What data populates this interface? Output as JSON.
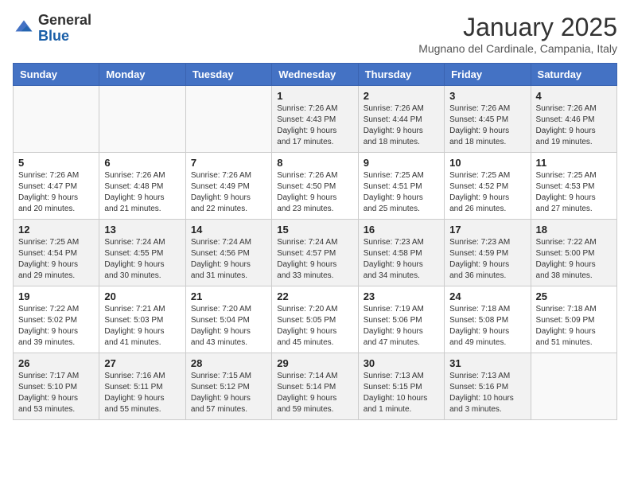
{
  "header": {
    "logo_general": "General",
    "logo_blue": "Blue",
    "month_year": "January 2025",
    "location": "Mugnano del Cardinale, Campania, Italy"
  },
  "weekdays": [
    "Sunday",
    "Monday",
    "Tuesday",
    "Wednesday",
    "Thursday",
    "Friday",
    "Saturday"
  ],
  "weeks": [
    [
      {
        "day": "",
        "info": ""
      },
      {
        "day": "",
        "info": ""
      },
      {
        "day": "",
        "info": ""
      },
      {
        "day": "1",
        "info": "Sunrise: 7:26 AM\nSunset: 4:43 PM\nDaylight: 9 hours\nand 17 minutes."
      },
      {
        "day": "2",
        "info": "Sunrise: 7:26 AM\nSunset: 4:44 PM\nDaylight: 9 hours\nand 18 minutes."
      },
      {
        "day": "3",
        "info": "Sunrise: 7:26 AM\nSunset: 4:45 PM\nDaylight: 9 hours\nand 18 minutes."
      },
      {
        "day": "4",
        "info": "Sunrise: 7:26 AM\nSunset: 4:46 PM\nDaylight: 9 hours\nand 19 minutes."
      }
    ],
    [
      {
        "day": "5",
        "info": "Sunrise: 7:26 AM\nSunset: 4:47 PM\nDaylight: 9 hours\nand 20 minutes."
      },
      {
        "day": "6",
        "info": "Sunrise: 7:26 AM\nSunset: 4:48 PM\nDaylight: 9 hours\nand 21 minutes."
      },
      {
        "day": "7",
        "info": "Sunrise: 7:26 AM\nSunset: 4:49 PM\nDaylight: 9 hours\nand 22 minutes."
      },
      {
        "day": "8",
        "info": "Sunrise: 7:26 AM\nSunset: 4:50 PM\nDaylight: 9 hours\nand 23 minutes."
      },
      {
        "day": "9",
        "info": "Sunrise: 7:25 AM\nSunset: 4:51 PM\nDaylight: 9 hours\nand 25 minutes."
      },
      {
        "day": "10",
        "info": "Sunrise: 7:25 AM\nSunset: 4:52 PM\nDaylight: 9 hours\nand 26 minutes."
      },
      {
        "day": "11",
        "info": "Sunrise: 7:25 AM\nSunset: 4:53 PM\nDaylight: 9 hours\nand 27 minutes."
      }
    ],
    [
      {
        "day": "12",
        "info": "Sunrise: 7:25 AM\nSunset: 4:54 PM\nDaylight: 9 hours\nand 29 minutes."
      },
      {
        "day": "13",
        "info": "Sunrise: 7:24 AM\nSunset: 4:55 PM\nDaylight: 9 hours\nand 30 minutes."
      },
      {
        "day": "14",
        "info": "Sunrise: 7:24 AM\nSunset: 4:56 PM\nDaylight: 9 hours\nand 31 minutes."
      },
      {
        "day": "15",
        "info": "Sunrise: 7:24 AM\nSunset: 4:57 PM\nDaylight: 9 hours\nand 33 minutes."
      },
      {
        "day": "16",
        "info": "Sunrise: 7:23 AM\nSunset: 4:58 PM\nDaylight: 9 hours\nand 34 minutes."
      },
      {
        "day": "17",
        "info": "Sunrise: 7:23 AM\nSunset: 4:59 PM\nDaylight: 9 hours\nand 36 minutes."
      },
      {
        "day": "18",
        "info": "Sunrise: 7:22 AM\nSunset: 5:00 PM\nDaylight: 9 hours\nand 38 minutes."
      }
    ],
    [
      {
        "day": "19",
        "info": "Sunrise: 7:22 AM\nSunset: 5:02 PM\nDaylight: 9 hours\nand 39 minutes."
      },
      {
        "day": "20",
        "info": "Sunrise: 7:21 AM\nSunset: 5:03 PM\nDaylight: 9 hours\nand 41 minutes."
      },
      {
        "day": "21",
        "info": "Sunrise: 7:20 AM\nSunset: 5:04 PM\nDaylight: 9 hours\nand 43 minutes."
      },
      {
        "day": "22",
        "info": "Sunrise: 7:20 AM\nSunset: 5:05 PM\nDaylight: 9 hours\nand 45 minutes."
      },
      {
        "day": "23",
        "info": "Sunrise: 7:19 AM\nSunset: 5:06 PM\nDaylight: 9 hours\nand 47 minutes."
      },
      {
        "day": "24",
        "info": "Sunrise: 7:18 AM\nSunset: 5:08 PM\nDaylight: 9 hours\nand 49 minutes."
      },
      {
        "day": "25",
        "info": "Sunrise: 7:18 AM\nSunset: 5:09 PM\nDaylight: 9 hours\nand 51 minutes."
      }
    ],
    [
      {
        "day": "26",
        "info": "Sunrise: 7:17 AM\nSunset: 5:10 PM\nDaylight: 9 hours\nand 53 minutes."
      },
      {
        "day": "27",
        "info": "Sunrise: 7:16 AM\nSunset: 5:11 PM\nDaylight: 9 hours\nand 55 minutes."
      },
      {
        "day": "28",
        "info": "Sunrise: 7:15 AM\nSunset: 5:12 PM\nDaylight: 9 hours\nand 57 minutes."
      },
      {
        "day": "29",
        "info": "Sunrise: 7:14 AM\nSunset: 5:14 PM\nDaylight: 9 hours\nand 59 minutes."
      },
      {
        "day": "30",
        "info": "Sunrise: 7:13 AM\nSunset: 5:15 PM\nDaylight: 10 hours\nand 1 minute."
      },
      {
        "day": "31",
        "info": "Sunrise: 7:13 AM\nSunset: 5:16 PM\nDaylight: 10 hours\nand 3 minutes."
      },
      {
        "day": "",
        "info": ""
      }
    ]
  ]
}
